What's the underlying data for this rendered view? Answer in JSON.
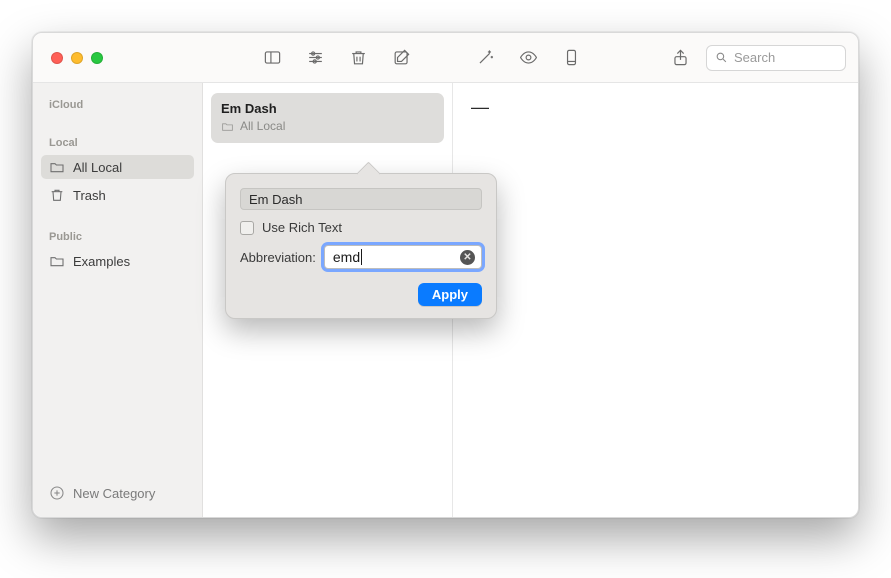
{
  "toolbar": {
    "search_placeholder": "Search"
  },
  "sidebar": {
    "sections": {
      "icloud": "iCloud",
      "local": "Local",
      "public": "Public"
    },
    "items": {
      "all_local": "All Local",
      "trash": "Trash",
      "examples": "Examples"
    },
    "footer": "New Category"
  },
  "list": {
    "card": {
      "title": "Em Dash",
      "sub": "All Local"
    }
  },
  "content": {
    "preview": "—"
  },
  "popover": {
    "name_value": "Em Dash",
    "rich_text_label": "Use Rich Text",
    "abbreviation_label": "Abbreviation:",
    "abbreviation_value": "emd",
    "apply_label": "Apply"
  }
}
